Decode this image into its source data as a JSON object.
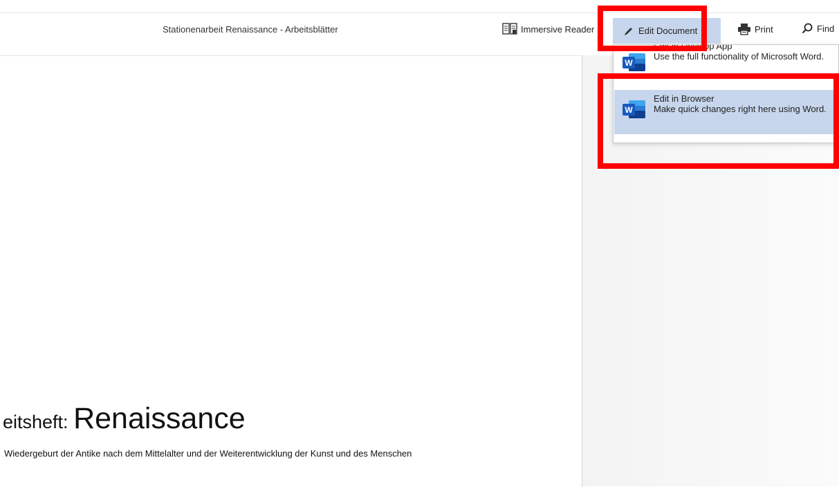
{
  "toolbar": {
    "document_title": "Stationenarbeit Renaissance - Arbeitsblätter",
    "immersive_reader_label": "Immersive Reader",
    "edit_document_label": "Edit Document",
    "edit_document_caret": "▾",
    "print_label": "Print",
    "find_label": "Find"
  },
  "edit_menu": {
    "items": [
      {
        "title": "Edit in Desktop App",
        "description": "Use the full functionality of Microsoft Word."
      },
      {
        "title": "Edit in Browser",
        "description": "Make quick changes right here using Word."
      }
    ]
  },
  "document": {
    "title_prefix": "eitsheft: ",
    "title_main": "Renaissance",
    "subtitle": "Wiedergeburt der Antike nach dem Mittelalter und der Weiterentwicklung der Kunst und des Menschen"
  },
  "colors": {
    "highlight": "#ff0000",
    "selected_bg": "#c7d6ec",
    "word_blue": "#185abd"
  },
  "icons": {
    "immersive_reader": "immersive-reader-icon",
    "edit": "pencil-icon",
    "print": "printer-icon",
    "find": "search-icon",
    "word": "word-icon"
  }
}
